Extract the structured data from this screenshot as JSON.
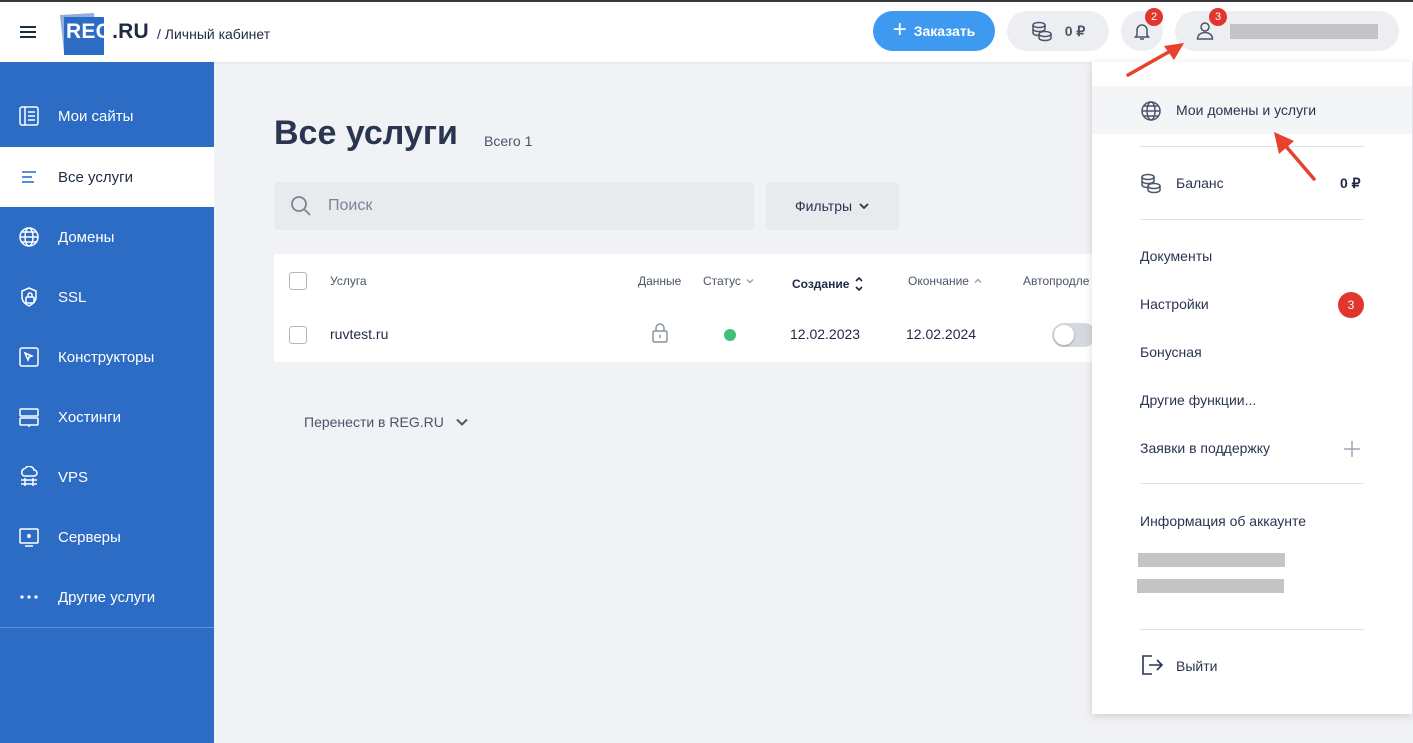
{
  "header": {
    "logo_text": "REG",
    "logo_suffix": ".RU",
    "breadcrumb": "/ Личный кабинет",
    "order_label": "Заказать",
    "balance": "0 ₽",
    "notifications_badge": "2",
    "user_badge": "3"
  },
  "sidebar": {
    "items": [
      {
        "label": "Мои сайты",
        "icon": "sites-icon"
      },
      {
        "label": "Все услуги",
        "icon": "list-icon",
        "active": true
      },
      {
        "label": "Домены",
        "icon": "globe-icon"
      },
      {
        "label": "SSL",
        "icon": "ssl-lock-icon"
      },
      {
        "label": "Конструкторы",
        "icon": "builder-icon"
      },
      {
        "label": "Хостинги",
        "icon": "hosting-icon"
      },
      {
        "label": "VPS",
        "icon": "vps-icon"
      },
      {
        "label": "Серверы",
        "icon": "server-icon"
      },
      {
        "label": "Другие услуги",
        "icon": "more-dots-icon"
      }
    ]
  },
  "main": {
    "title": "Все услуги",
    "total": "Всего 1",
    "search_placeholder": "Поиск",
    "filters_label": "Фильтры",
    "table": {
      "columns": [
        "Услуга",
        "Данные",
        "Статус",
        "Создание",
        "Окончание",
        "Автопродле"
      ],
      "rows": [
        {
          "service": "ruvtest.ru",
          "created": "12.02.2023",
          "expires": "12.02.2024",
          "status": "active",
          "autorenew": false
        }
      ]
    },
    "transfer_label": "Перенести в REG.RU"
  },
  "dropdown": {
    "my_domains": "Мои домены и услуги",
    "balance_label": "Баланс",
    "balance_value": "0 ₽",
    "documents": "Документы",
    "settings": "Настройки",
    "settings_badge": "3",
    "bonus": "Бонусная",
    "other_functions": "Другие функции...",
    "support_tickets": "Заявки в поддержку",
    "account_info": "Информация об аккаунте",
    "logout": "Выйти"
  },
  "colors": {
    "sidebar": "#2d6cc4",
    "accent": "#3d9af0",
    "badge": "#e0362e",
    "status_ok": "#3fbf7a",
    "annotation_arrow": "#e8412c"
  }
}
